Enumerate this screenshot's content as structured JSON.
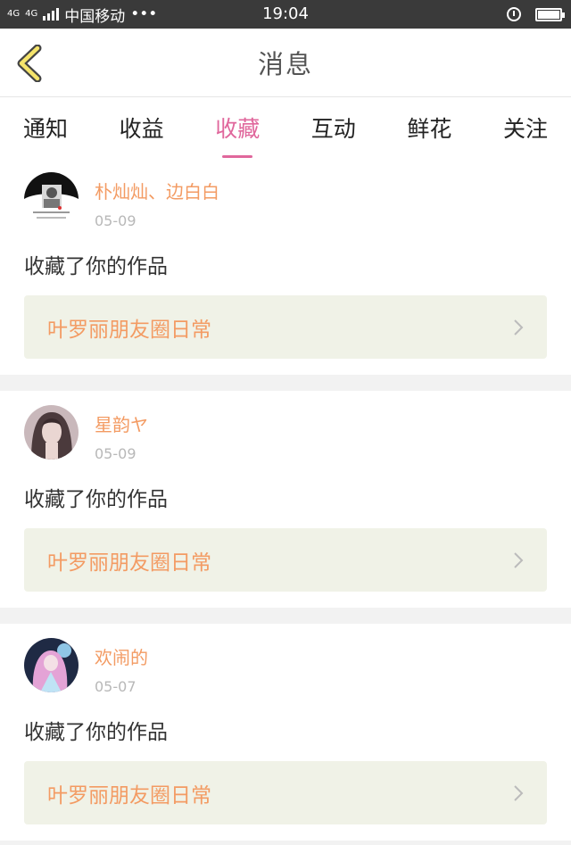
{
  "status_bar": {
    "network": "4G",
    "network2": "4G",
    "carrier": "中国移动",
    "dots": "•••",
    "time": "19:04",
    "battery_level": 1.0
  },
  "header": {
    "title": "消息",
    "back_icon": "chevron-left-icon"
  },
  "tabs": [
    {
      "label": "通知",
      "active": false
    },
    {
      "label": "收益",
      "active": false
    },
    {
      "label": "收藏",
      "active": true
    },
    {
      "label": "互动",
      "active": false
    },
    {
      "label": "鲜花",
      "active": false
    },
    {
      "label": "关注",
      "active": false
    }
  ],
  "colors": {
    "accent_pink": "#e0679c",
    "name_orange": "#f39b63",
    "work_bg": "#f0f2e7"
  },
  "messages": [
    {
      "name": "朴灿灿、边白白",
      "date": "05-09",
      "action": "收藏了你的作品",
      "work_title": "叶罗丽朋友圈日常"
    },
    {
      "name": "星韵ヤ",
      "date": "05-09",
      "action": "收藏了你的作品",
      "work_title": "叶罗丽朋友圈日常"
    },
    {
      "name": "欢闹的",
      "date": "05-07",
      "action": "收藏了你的作品",
      "work_title": "叶罗丽朋友圈日常"
    }
  ]
}
